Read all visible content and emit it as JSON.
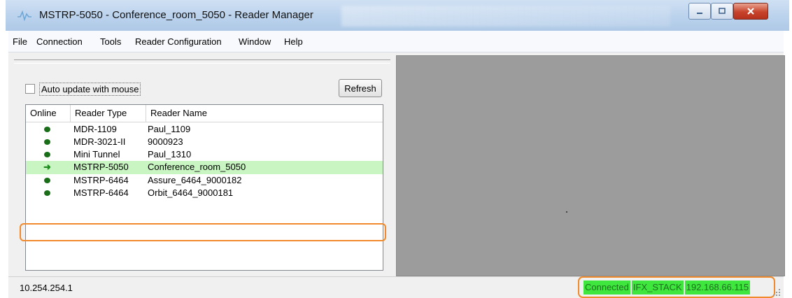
{
  "window": {
    "title": "MSTRP-5050 - Conference_room_5050 - Reader Manager"
  },
  "menu": [
    "File",
    "Connection",
    "Tools",
    "Reader Configuration",
    "Window",
    "Help"
  ],
  "left_pane": {
    "auto_update_label": "Auto update with mouse",
    "auto_update_checked": false,
    "refresh_label": "Refresh"
  },
  "reader_list": {
    "columns": [
      "Online",
      "Reader Type",
      "Reader Name"
    ],
    "rows": [
      {
        "online": "online",
        "type": "MDR-1109",
        "name": "Paul_1109"
      },
      {
        "online": "online",
        "type": "MDR-3021-II",
        "name": "9000923"
      },
      {
        "online": "online",
        "type": "Mini Tunnel",
        "name": "Paul_1310"
      },
      {
        "online": "connected",
        "type": "MSTRP-5050",
        "name": "Conference_room_5050"
      },
      {
        "online": "online",
        "type": "MSTRP-6464",
        "name": "Assure_6464_9000182"
      },
      {
        "online": "online",
        "type": "MSTRP-6464",
        "name": "Orbit_6464_9000181"
      }
    ],
    "selected_index": 3
  },
  "status_bar": {
    "ip": "10.254.254.1",
    "connection": "Connected",
    "stack": "IFX_STACK",
    "reader_ip": "192.168.66.115"
  },
  "colors": {
    "status_green": "#3ee63e",
    "selected_row": "#c9f5c2",
    "highlight_outline": "#f08a2c",
    "online_dot": "#1a6e1a"
  },
  "icons": {
    "app": "reader-manager-icon",
    "online": "online-dot-icon",
    "connected": "connected-arrow-icon"
  }
}
